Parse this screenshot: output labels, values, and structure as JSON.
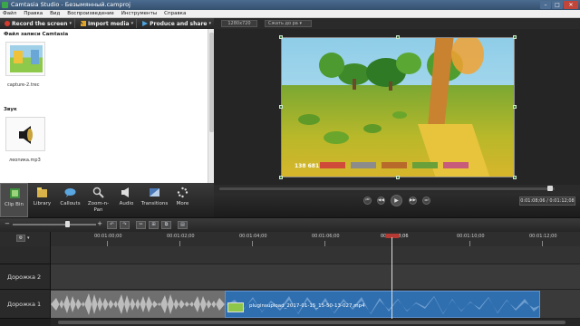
{
  "window": {
    "title": "Camtasia Studio - Безымянный.camproj",
    "controls": [
      "–",
      "□",
      "✕"
    ]
  },
  "menu": [
    "Файл",
    "Правка",
    "Вид",
    "Воспроизведение",
    "Инструменты",
    "Справка"
  ],
  "toolbar": {
    "record_label": "Record the screen",
    "import_label": "Import media",
    "produce_label": "Produce and share"
  },
  "clipbin": {
    "recordings_header": "Файл записи Camtasia",
    "recordings": [
      {
        "name": "capture-2.trec"
      }
    ],
    "audio_header": "Звук",
    "audio": [
      {
        "name": "леопика.mp3"
      }
    ]
  },
  "tabs": [
    {
      "label": "Clip Bin",
      "icon": "film-strip-icon",
      "active": true
    },
    {
      "label": "Library",
      "icon": "library-folder-icon",
      "active": false
    },
    {
      "label": "Callouts",
      "icon": "speech-bubble-icon",
      "active": false
    },
    {
      "label": "Zoom-n-Pan",
      "icon": "magnifier-icon",
      "active": false
    },
    {
      "label": "Audio",
      "icon": "speaker-icon",
      "active": false
    },
    {
      "label": "Transitions",
      "icon": "transition-icon",
      "active": false
    },
    {
      "label": "More",
      "icon": "more-dots-icon",
      "active": false
    }
  ],
  "preview": {
    "size_value": "1280x720",
    "fit_label": "Сжать до ра",
    "hud_score": "138 681"
  },
  "transport": {
    "timecode": "0:01:08;06 / 0:01:12;08",
    "buttons": [
      "prev",
      "rewind",
      "play",
      "forward",
      "next"
    ]
  },
  "timeline": {
    "ruler_labels": [
      "00:01:00;00",
      "00:01:02;00",
      "00:01:04;00",
      "00:01:06;00",
      "00:01:08;06",
      "00:01:10;00",
      "00:01:12;00"
    ],
    "tracks": [
      {
        "name": "Дорожка 2"
      },
      {
        "name": "Дорожка 1",
        "clip_label": "pluginsupload_2017-01-15_15-50-13-027.mp4"
      }
    ]
  },
  "colors": {
    "accent_red": "#b43a33",
    "clip_blue": "#2f6fb0",
    "audio_grey": "#7b7b7b"
  }
}
